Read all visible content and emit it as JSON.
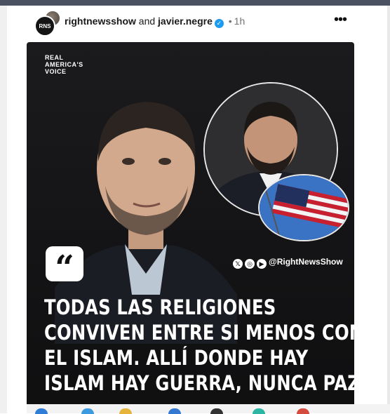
{
  "post": {
    "user_primary": "rightnewsshow",
    "connector": "and",
    "user_secondary": "javier.negre",
    "separator": "•",
    "time": "1h",
    "more_label": "•••",
    "avatar_text": "RNS"
  },
  "media": {
    "brand_line1": "REAL",
    "brand_line2": "AMERICA'S",
    "brand_line3": "VOICE",
    "quote_mark": "“",
    "social_handle": "@RightNewsShow",
    "headline_lines": [
      "TODAS LAS RELIGIONES",
      "CONVIVEN ENTRE SI MENOS CON",
      "EL ISLAM. ALLÍ DONDE HAY",
      "ISLAM HAY GUERRA, NUNCA PAZ"
    ]
  },
  "colors": {
    "verified": "#1d9bf0",
    "media_bg": "#141416",
    "headline": "#ffffff"
  }
}
